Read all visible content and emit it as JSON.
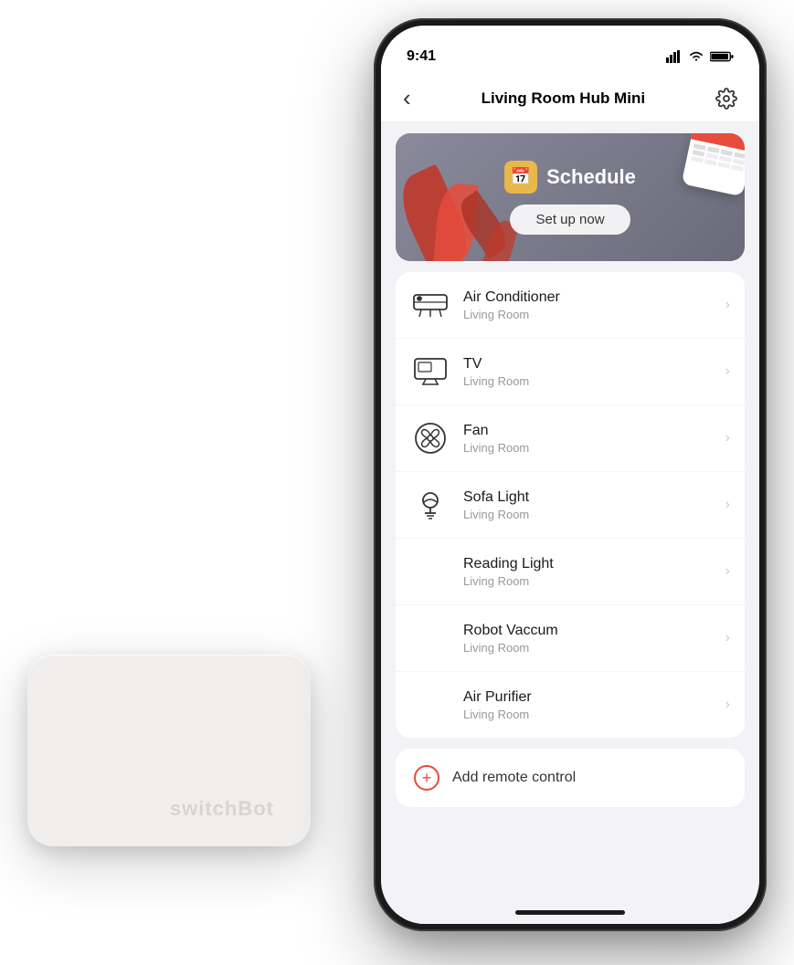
{
  "page": {
    "background": "#ffffff"
  },
  "hub": {
    "brand": "switchBot"
  },
  "phone": {
    "status_bar": {
      "time": "9:41"
    },
    "nav": {
      "title": "Living Room Hub Mini",
      "back_label": "‹"
    },
    "schedule_card": {
      "label": "Schedule",
      "setup_button": "Set up now"
    },
    "devices": [
      {
        "name": "Air Conditioner",
        "room": "Living Room",
        "icon_type": "ac"
      },
      {
        "name": "TV",
        "room": "Living Room",
        "icon_type": "tv"
      },
      {
        "name": "Fan",
        "room": "Living Room",
        "icon_type": "fan"
      },
      {
        "name": "Sofa Light",
        "room": "Living Room",
        "icon_type": "light"
      },
      {
        "name": "Reading Light",
        "room": "Living Room",
        "icon_type": "light2"
      },
      {
        "name": "Robot Vaccum",
        "room": "Living Room",
        "icon_type": "robot"
      },
      {
        "name": "Air Purifier",
        "room": "Living Room",
        "icon_type": "purifier"
      }
    ],
    "add_remote": {
      "label": "Add remote control"
    }
  }
}
